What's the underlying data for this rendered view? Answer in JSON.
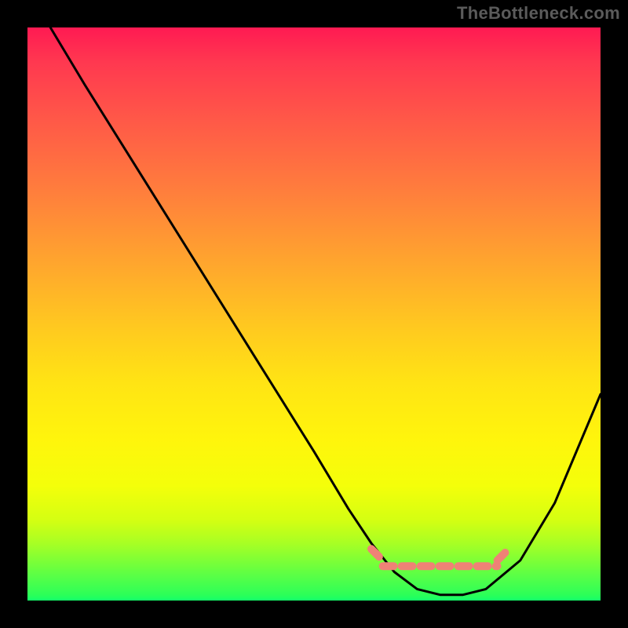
{
  "watermark": "TheBottleneck.com",
  "chart_data": {
    "type": "line",
    "title": "",
    "xlabel": "",
    "ylabel": "",
    "xlim": [
      0,
      100
    ],
    "ylim": [
      0,
      100
    ],
    "series": [
      {
        "name": "curve",
        "x": [
          4,
          10,
          20,
          30,
          40,
          50,
          56,
          60,
          64,
          68,
          72,
          76,
          80,
          86,
          92,
          100
        ],
        "y": [
          100,
          90,
          74,
          58,
          42,
          26,
          16,
          10,
          5,
          2,
          1,
          1,
          2,
          7,
          17,
          36
        ]
      }
    ],
    "annotations": [
      {
        "name": "flat-band",
        "type": "segment",
        "color": "#ef8276",
        "x": [
          62,
          82
        ],
        "y": [
          6,
          6
        ]
      },
      {
        "name": "flat-band-left-dash",
        "type": "segment",
        "color": "#ef8276",
        "x": [
          60,
          62
        ],
        "y": [
          9,
          7
        ]
      },
      {
        "name": "flat-band-right-dash",
        "type": "segment",
        "color": "#ef8276",
        "x": [
          82,
          84
        ],
        "y": [
          7,
          9
        ]
      }
    ]
  }
}
